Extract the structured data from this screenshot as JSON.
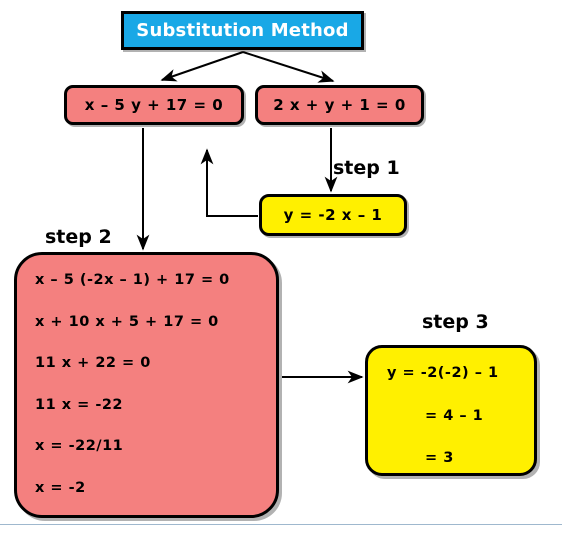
{
  "diagram": {
    "title": "Substitution Method",
    "colors": {
      "title_fill": "#19A8E6",
      "title_text": "#FFFFFF",
      "equation_fill": "#F4807F",
      "step_fill": "#FFF000",
      "border": "#000000",
      "bottom_rule": "#9FB8CE"
    },
    "equations": [
      {
        "label": "x – 5 y + 17 = 0"
      },
      {
        "label": "2 x + y + 1 = 0"
      }
    ],
    "steps": [
      {
        "label": "step 1",
        "lines": [
          "y = -2 x – 1"
        ]
      },
      {
        "label": "step 2",
        "lines": [
          "x – 5 (-2x – 1) + 17 = 0",
          "x + 10 x + 5 + 17 = 0",
          "11 x + 22 = 0",
          "11 x = -22",
          "x = -22/11",
          "x = -2"
        ]
      },
      {
        "label": "step 3",
        "lines": [
          "y = -2(-2) – 1",
          "= 4 – 1",
          "= 3"
        ]
      }
    ]
  }
}
